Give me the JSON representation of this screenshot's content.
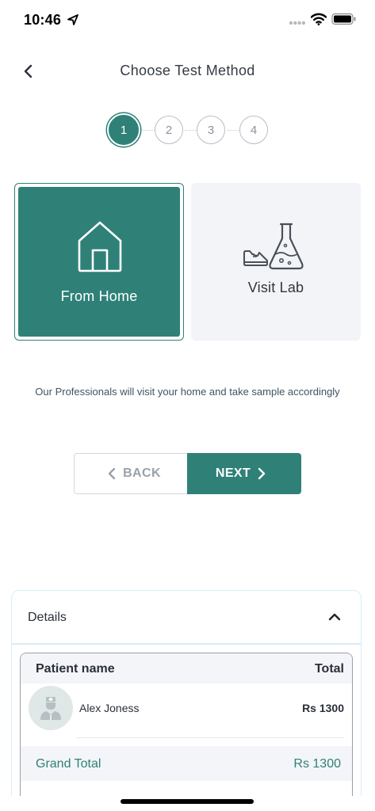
{
  "status_bar": {
    "time": "10:46",
    "icons": [
      "location-arrow-icon",
      "cellular-signal-icon",
      "wifi-icon",
      "battery-icon"
    ]
  },
  "nav": {
    "title": "Choose Test Method",
    "back_icon": "chevron-left-icon"
  },
  "stepper": {
    "steps": [
      "1",
      "2",
      "3",
      "4"
    ],
    "active_step": 1
  },
  "options": {
    "home": {
      "label": "From Home",
      "icon": "house-icon",
      "selected": true
    },
    "lab": {
      "label": "Visit Lab",
      "icon": "shoe-and-flask-icon",
      "selected": false
    }
  },
  "hint_text": "Our Professionals will visit your home and take sample accordingly",
  "buttons": {
    "back_label": "BACK",
    "next_label": "NEXT"
  },
  "details": {
    "title": "Details",
    "table": {
      "col_name": "Patient name",
      "col_total": "Total",
      "rows": [
        {
          "name": "Alex Joness",
          "amount": "Rs 1300",
          "avatar_icon": "doctor-avatar-icon"
        }
      ],
      "grand_total_label": "Grand Total",
      "grand_total_value": "Rs 1300"
    }
  },
  "colors": {
    "accent": "#2f8178",
    "card_bg": "#f3f4f8",
    "text_dark": "#2a3038",
    "text_muted": "#9aa1aa"
  }
}
